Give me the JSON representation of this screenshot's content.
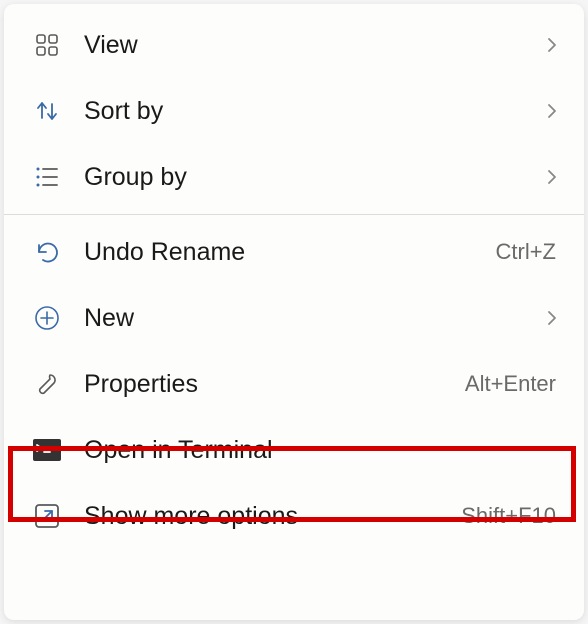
{
  "menu": {
    "view": {
      "label": "View"
    },
    "sortby": {
      "label": "Sort by"
    },
    "groupby": {
      "label": "Group by"
    },
    "undo": {
      "label": "Undo Rename",
      "shortcut": "Ctrl+Z"
    },
    "new": {
      "label": "New"
    },
    "properties": {
      "label": "Properties",
      "shortcut": "Alt+Enter"
    },
    "terminal": {
      "label": "Open in Terminal"
    },
    "moreoptions": {
      "label": "Show more options",
      "shortcut": "Shift+F10"
    }
  }
}
